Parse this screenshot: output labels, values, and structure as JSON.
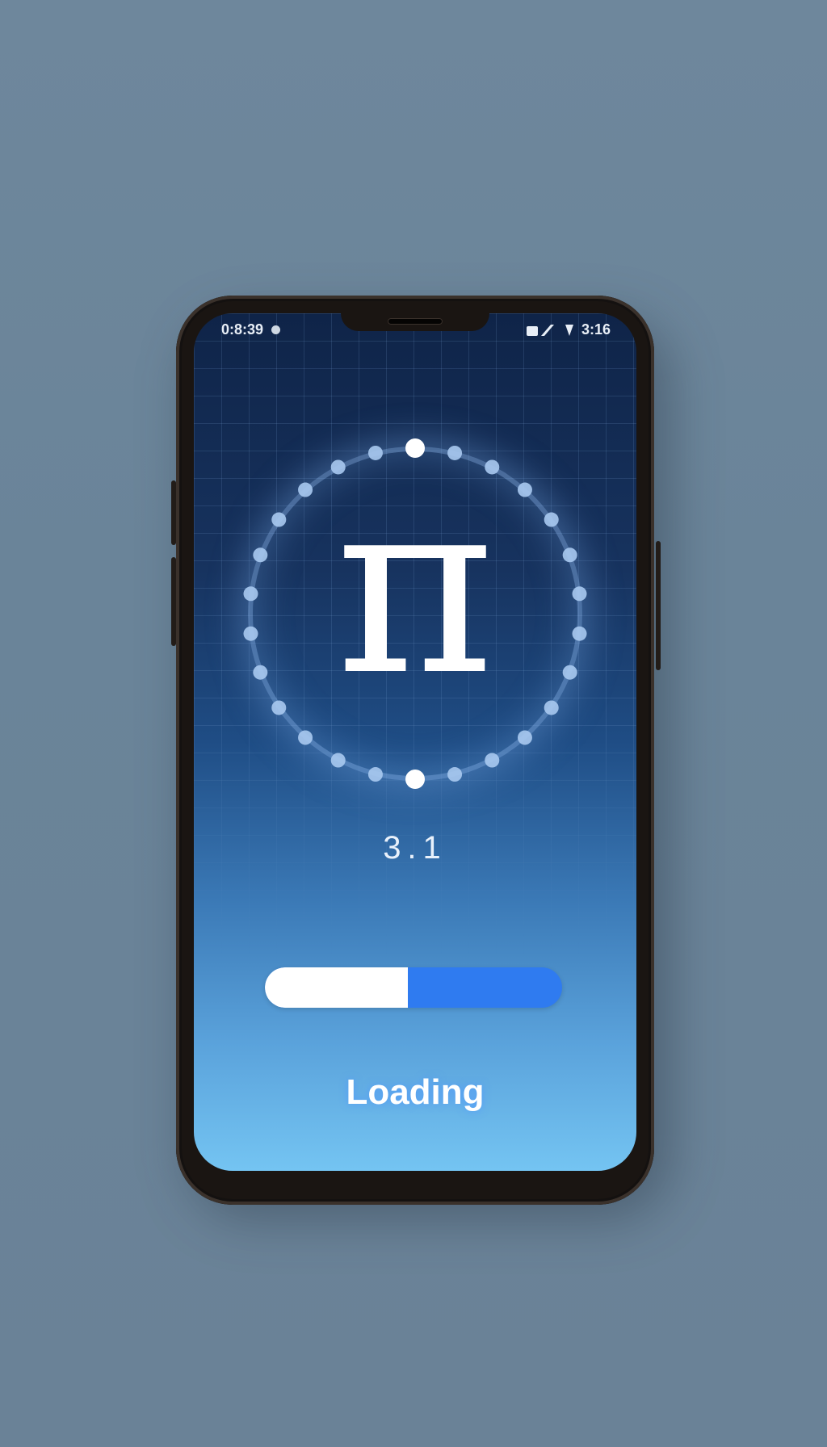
{
  "status_bar": {
    "time": "0:8:39",
    "left_icon": "location-dot-icon",
    "right_icons": [
      "signal-icon",
      "battery-icon"
    ],
    "right_text": "3:16"
  },
  "loader": {
    "symbol": "π",
    "digits": "3.1",
    "progress_fraction": 0.48,
    "label": "Loading"
  },
  "colors": {
    "accent": "#2f7bf0",
    "ring": "#a9c9f0",
    "background": "#6a8499"
  }
}
